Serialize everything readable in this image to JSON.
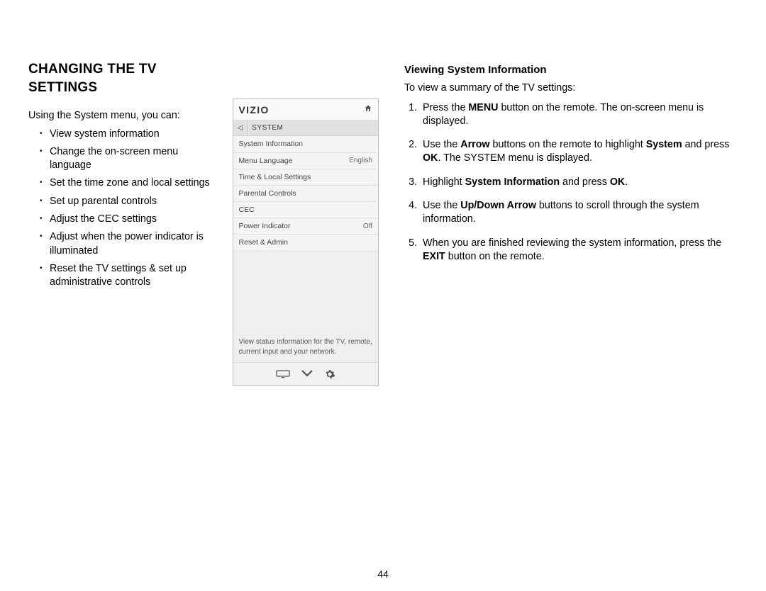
{
  "page_number": "44",
  "left": {
    "title": "CHANGING THE TV SETTINGS",
    "intro": "Using the System menu, you can:",
    "bullets": [
      "View system information",
      "Change the on-screen menu language",
      "Set the time zone and local settings",
      "Set up parental controls",
      "Adjust the CEC settings",
      "Adjust when the power indicator is illuminated",
      "Reset the TV settings & set up administrative controls"
    ]
  },
  "figure": {
    "brand": "VIZIO",
    "menu_title": "SYSTEM",
    "items": [
      {
        "label": "System Information",
        "value": ""
      },
      {
        "label": "Menu Language",
        "value": "English"
      },
      {
        "label": "Time & Local Settings",
        "value": ""
      },
      {
        "label": "Parental Controls",
        "value": ""
      },
      {
        "label": "CEC",
        "value": ""
      },
      {
        "label": "Power Indicator",
        "value": "Off"
      },
      {
        "label": "Reset & Admin",
        "value": ""
      }
    ],
    "help_text": "View status information for the TV, remote, current input and your network."
  },
  "right": {
    "subhead": "Viewing System Information",
    "lead": "To view a summary of the TV settings:",
    "steps": {
      "s1_a": "Press the ",
      "s1_b": "MENU",
      "s1_c": " button on the remote. The on-screen menu is displayed.",
      "s2_a": "Use the ",
      "s2_b": "Arrow",
      "s2_c": " buttons on the remote to highlight ",
      "s2_d": "System",
      "s2_e": " and press ",
      "s2_f": "OK",
      "s2_g": ". The SYSTEM menu is displayed.",
      "s3_a": "Highlight ",
      "s3_b": "System Information",
      "s3_c": " and press ",
      "s3_d": "OK",
      "s3_e": ".",
      "s4_a": "Use the ",
      "s4_b": "Up/Down Arrow",
      "s4_c": " buttons to scroll through the system information.",
      "s5_a": "When you are finished reviewing the system information, press the ",
      "s5_b": "EXIT",
      "s5_c": " button on the remote."
    }
  }
}
